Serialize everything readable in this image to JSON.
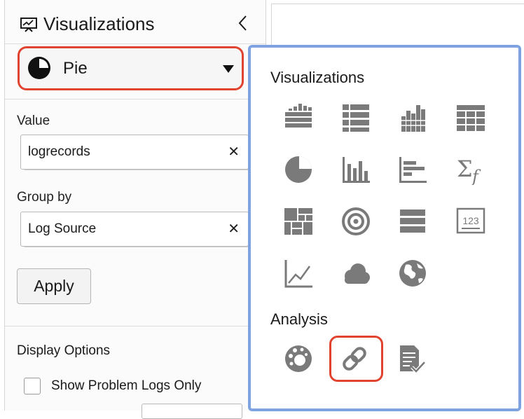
{
  "panel": {
    "title": "Visualizations",
    "selected_type": "Pie",
    "value_label": "Value",
    "value_field": "logrecords",
    "groupby_label": "Group by",
    "groupby_field": "Log Source",
    "clear_glyph": "✕",
    "apply_label": "Apply",
    "display_options_label": "Display Options",
    "show_problem_logs_label": "Show Problem Logs Only",
    "show_problem_logs_checked": false
  },
  "popup": {
    "visualizations_heading": "Visualizations",
    "analysis_heading": "Analysis",
    "visualization_icons": [
      "bar-table-icon",
      "list-table-icon",
      "histogram-icon",
      "grid-icon",
      "pie-chart-icon",
      "bar-chart-icon",
      "horizontal-bar-chart-icon",
      "sum-function-icon",
      "treemap-icon",
      "sunburst-icon",
      "records-list-icon",
      "summary-tile-icon",
      "line-chart-icon",
      "word-cloud-icon",
      "map-icon"
    ],
    "tile_number": "123",
    "sum_symbol": "Σ",
    "sum_subscript": "f",
    "analysis_icons": [
      "cluster-icon",
      "link-icon",
      "pattern-icon"
    ],
    "selected_analysis": "link-icon"
  },
  "colors": {
    "highlight": "#e0432f",
    "popup_border": "#7ea3e0",
    "icon_gray": "#7a7a7a"
  }
}
